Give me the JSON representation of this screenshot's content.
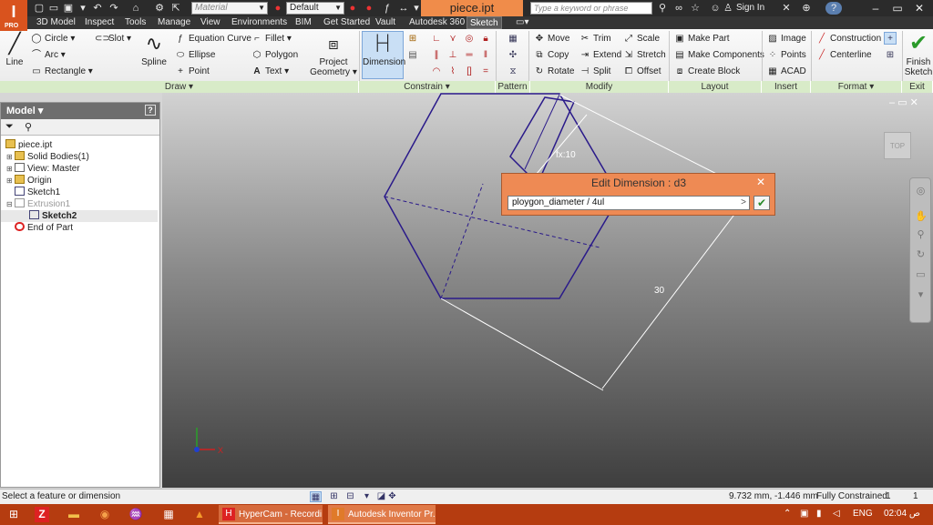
{
  "titlebar": {
    "app_letter": "I",
    "app_edition": "PRO",
    "material_placeholder": "Material",
    "appearance_value": "Default",
    "document_title": "piece.ipt",
    "search_placeholder": "Type a keyword or phrase",
    "sign_in": "Sign In",
    "help": "?"
  },
  "tabs": [
    "3D Model",
    "Inspect",
    "Tools",
    "Manage",
    "View",
    "Environments",
    "BIM",
    "Get Started",
    "Vault",
    "Autodesk 360",
    "Sketch"
  ],
  "ribbon": {
    "draw": {
      "label": "Draw",
      "line": "Line",
      "circle": "Circle",
      "arc": "Arc",
      "rectangle": "Rectangle",
      "slot": "Slot",
      "spline": "Spline",
      "equation_curve": "Equation Curve",
      "ellipse": "Ellipse",
      "point": "Point",
      "fillet": "Fillet",
      "polygon": "Polygon",
      "text": "Text",
      "project_geometry_1": "Project",
      "project_geometry_2": "Geometry"
    },
    "constrain": {
      "label": "Constrain",
      "dimension": "Dimension"
    },
    "pattern": {
      "label": "Pattern"
    },
    "modify": {
      "label": "Modify",
      "move": "Move",
      "copy": "Copy",
      "rotate": "Rotate",
      "trim": "Trim",
      "extend": "Extend",
      "split": "Split",
      "scale": "Scale",
      "stretch": "Stretch",
      "offset": "Offset"
    },
    "layout": {
      "label": "Layout",
      "make_part": "Make Part",
      "make_components": "Make Components",
      "create_block": "Create Block"
    },
    "insert": {
      "label": "Insert",
      "image": "Image",
      "points": "Points",
      "acad": "ACAD"
    },
    "format": {
      "label": "Format",
      "construction": "Construction",
      "centerline": "Centerline"
    },
    "exit": {
      "label": "Exit",
      "finish_1": "Finish",
      "finish_2": "Sketch"
    }
  },
  "browser": {
    "title": "Model",
    "items": [
      {
        "label": "piece.ipt"
      },
      {
        "label": "Solid Bodies(1)"
      },
      {
        "label": "View: Master"
      },
      {
        "label": "Origin"
      },
      {
        "label": "Sketch1"
      },
      {
        "label": "Extrusion1"
      },
      {
        "label": "Sketch2"
      },
      {
        "label": "End of Part"
      }
    ]
  },
  "viewport": {
    "viewcube_label": "TOP",
    "dimension_fx": "fx:10",
    "dimension_30": "30",
    "axis_x": "X"
  },
  "edit_dimension": {
    "title": "Edit Dimension : d3",
    "value": "ploygon_diameter / 4ul"
  },
  "statusbar": {
    "prompt": "Select a feature or dimension",
    "coordinates": "9.732 mm, -1.446 mm",
    "state": "Fully Constrained",
    "count_a": "1",
    "count_b": "1"
  },
  "taskbar": {
    "apps": [
      "HyperCam - Recordi...",
      "Autodesk Inventor Pr..."
    ],
    "language": "ENG",
    "time": "02:04 ص"
  },
  "colors": {
    "accent": "#f08c4a",
    "panel_label_bg": "#d8ebc8",
    "taskbar": "#b53c10",
    "sketch_line": "#2a1a8a"
  }
}
